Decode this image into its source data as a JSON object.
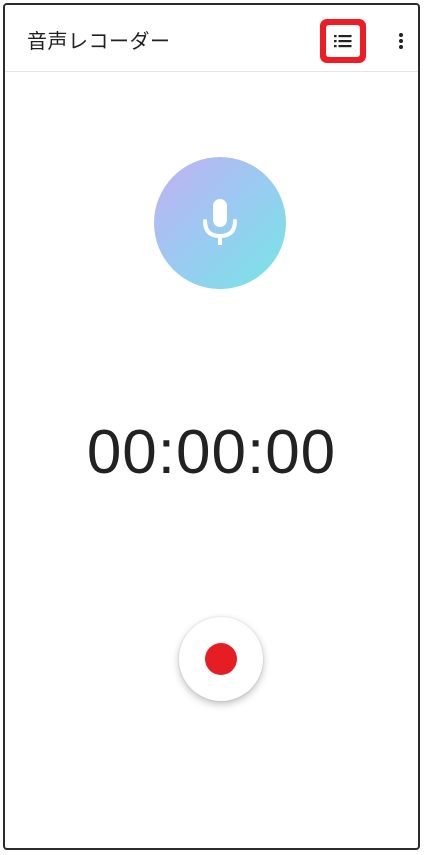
{
  "app": {
    "title": "音声レコーダー"
  },
  "toolbar": {
    "list_icon": "list-icon",
    "more_icon": "more-vert-icon",
    "highlight_color": "#ee1c25"
  },
  "main": {
    "mic_icon": "microphone-icon",
    "timer": "00:00:00",
    "record_icon": "record-icon",
    "record_color": "#e61e24"
  }
}
